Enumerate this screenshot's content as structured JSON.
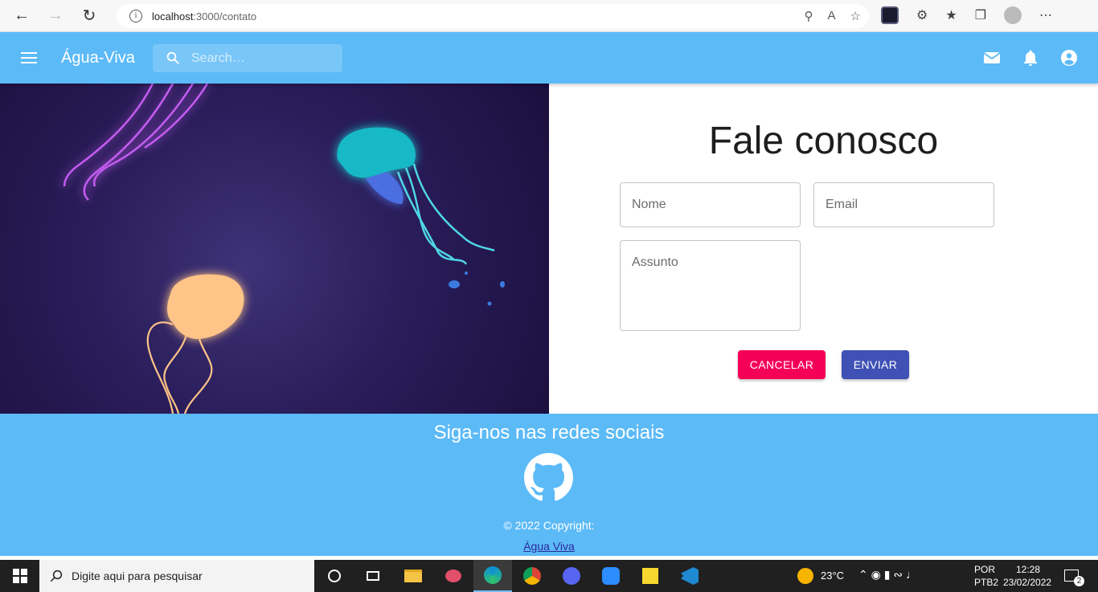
{
  "browser": {
    "url_host": "localhost",
    "url_path": ":3000/contato"
  },
  "app_bar": {
    "title": "Água-Viva",
    "search_placeholder": "Search…",
    "icons": [
      "menu-icon",
      "search-icon",
      "mail-icon",
      "bell-icon",
      "account-icon"
    ]
  },
  "form": {
    "title": "Fale conosco",
    "name_placeholder": "Nome",
    "email_placeholder": "Email",
    "subject_placeholder": "Assunto",
    "cancel_label": "CANCELAR",
    "send_label": "ENVIAR",
    "cancel_color": "#f50057",
    "send_color": "#3f51b5"
  },
  "footer": {
    "title": "Siga-nos nas redes sociais",
    "copyright": "© 2022 Copyright:",
    "link_label": "Água Viva",
    "icon": "github-icon"
  },
  "colors": {
    "primary": "#5cbaf7",
    "hero_bg": "#2a1d5a"
  },
  "taskbar": {
    "search_text": "Digite aqui para pesquisar",
    "weather": "23°C",
    "language_1": "POR",
    "language_2": "PTB2",
    "time": "12:28",
    "date": "23/02/2022",
    "notifications": "2"
  }
}
